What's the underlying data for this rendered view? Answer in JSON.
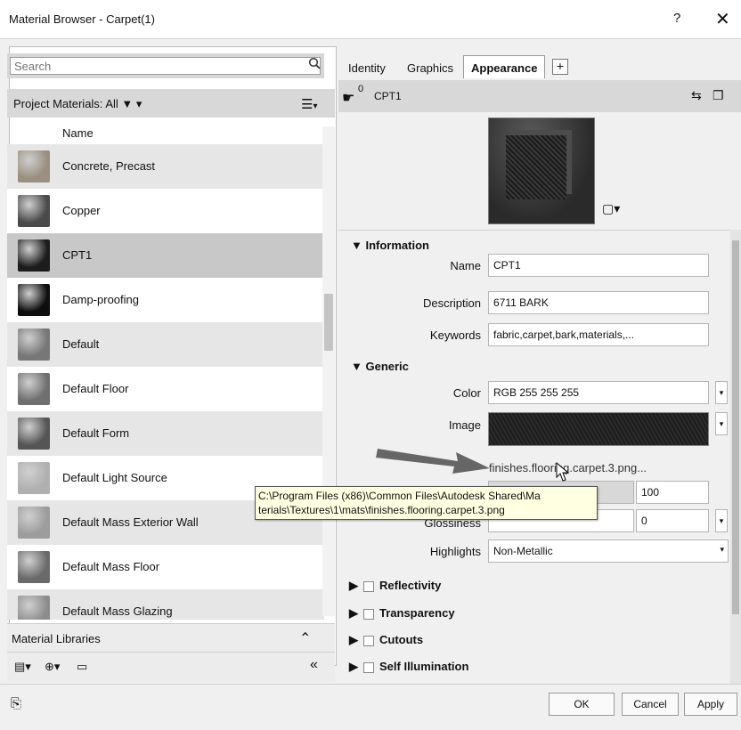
{
  "window": {
    "title": "Material Browser - Carpet(1)",
    "help": "?",
    "close": "✕"
  },
  "search": {
    "placeholder": "Search",
    "icon": "search-icon"
  },
  "project_bar": {
    "label": "Project Materials: All",
    "filter_icon": "▼",
    "view_icon": "☰"
  },
  "list": {
    "header": "Name",
    "items": [
      {
        "label": "Concrete, Precast",
        "thumb": "#9a8f80"
      },
      {
        "label": "Copper",
        "thumb": "#4a4a4a"
      },
      {
        "label": "CPT1",
        "thumb": "#1c1c1c",
        "selected": true
      },
      {
        "label": "Damp-proofing",
        "thumb": "#0e0e0e"
      },
      {
        "label": "Default",
        "thumb": "#777777"
      },
      {
        "label": "Default Floor",
        "thumb": "#6f6f6f"
      },
      {
        "label": "Default Form",
        "thumb": "#555555"
      },
      {
        "label": "Default Light Source",
        "thumb": "#b0b0b0"
      },
      {
        "label": "Default Mass Exterior Wall",
        "thumb": "#9c9c9c"
      },
      {
        "label": "Default Mass Floor",
        "thumb": "#6a6a6a"
      },
      {
        "label": "Default Mass Glazing",
        "thumb": "#8c8c8c"
      }
    ]
  },
  "libraries": {
    "label": "Material Libraries",
    "collapse": "⌃"
  },
  "toolbar": {
    "lib_btn": "▤▾",
    "add_btn": "⊕▾",
    "view_btn": "▭",
    "collapse_btn": "«"
  },
  "tabs": [
    {
      "label": "Identity"
    },
    {
      "label": "Graphics"
    },
    {
      "label": "Appearance",
      "active": true
    }
  ],
  "tab_add": "+",
  "asset": {
    "count": "0",
    "name": "CPT1"
  },
  "information": {
    "title": "Information",
    "name_label": "Name",
    "name_value": "CPT1",
    "desc_label": "Description",
    "desc_value": "6711 BARK",
    "kw_label": "Keywords",
    "kw_value": "fabric,carpet,bark,materials,..."
  },
  "generic": {
    "title": "Generic",
    "color_label": "Color",
    "color_value": "RGB 255 255 255",
    "image_label": "Image",
    "image_file": "finishes.flooring.carpet.3.png...",
    "fade_value": "100",
    "gloss_label": "Glossiness",
    "gloss_value": "0",
    "highlights_label": "Highlights",
    "highlights_value": "Non-Metallic"
  },
  "collapsed_sections": [
    "Reflectivity",
    "Transparency",
    "Cutouts",
    "Self Illumination"
  ],
  "tooltip": {
    "line1": "C:\\Program Files (x86)\\Common Files\\Autodesk Shared\\Ma",
    "line2": "terials\\Textures\\1\\mats\\finishes.flooring.carpet.3.png"
  },
  "footer": {
    "ok": "OK",
    "cancel": "Cancel",
    "apply": "Apply"
  }
}
